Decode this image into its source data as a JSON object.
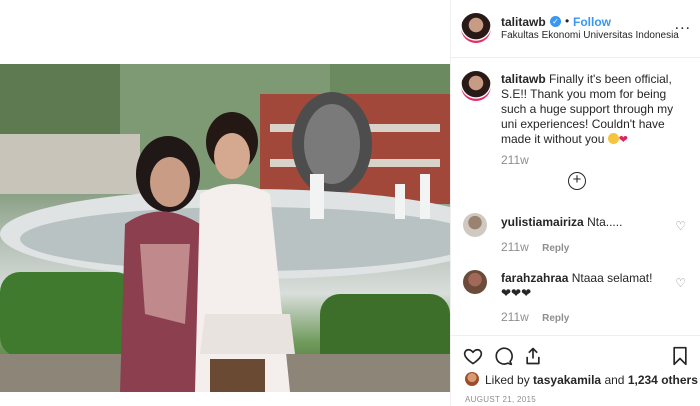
{
  "post": {
    "author": "talitawb",
    "follow_label": "Follow",
    "dot": "•",
    "location": "Fakultas Ekonomi Universitas Indonesia",
    "more_label": "...",
    "caption_text": "Finally it's been official, S.E!! Thank you mom for being such a huge support through my uni experiences! Couldn't have made it without you",
    "caption_time": "211w"
  },
  "load_more_label": "+",
  "comments": [
    {
      "user": "yulistiamairiza",
      "text": "Nta.....",
      "time": "211w",
      "reply": "Reply"
    },
    {
      "user": "farahzahraa",
      "text": "Ntaaa selamat!",
      "hearts": "❤❤❤",
      "time": "211w",
      "reply": "Reply"
    }
  ],
  "likes": {
    "prefix": "Liked by",
    "user": "tasyakamila",
    "connector": "and",
    "others": "1,234 others"
  },
  "date": "AUGUST 21, 2015",
  "colors": {
    "accent": "#3897f0",
    "muted": "#8e8e8e",
    "text": "#262626"
  },
  "icons": [
    "heart-icon",
    "comment-icon",
    "share-icon",
    "bookmark-icon",
    "verified-badge-icon",
    "plus-circle-icon"
  ]
}
